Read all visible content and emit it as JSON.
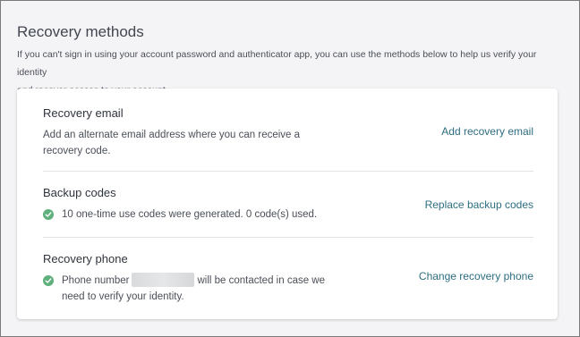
{
  "page": {
    "title": "Recovery methods",
    "intro_line1": "If you can't sign in using your account password and authenticator app, you can use the methods below to help us verify your identity",
    "intro_line2": "and recover access to your account."
  },
  "recovery_email": {
    "title": "Recovery email",
    "desc_line1": "Add an alternate email address where you can receive a",
    "desc_line2": "recovery code.",
    "action": "Add recovery email"
  },
  "backup_codes": {
    "title": "Backup codes",
    "status": "10 one-time use codes were generated. 0 code(s) used.",
    "action": "Replace backup codes"
  },
  "recovery_phone": {
    "title": "Recovery phone",
    "status_prefix": "Phone number",
    "status_suffix_line1": "will be contacted in case we",
    "status_line2": "need to verify your identity.",
    "action": "Change recovery phone"
  },
  "colors": {
    "link": "#2e6e82",
    "check": "#5fb07c",
    "card_bg": "#ffffff",
    "page_bg": "#f4f4f6"
  },
  "icons": [
    "check-circle-icon"
  ]
}
